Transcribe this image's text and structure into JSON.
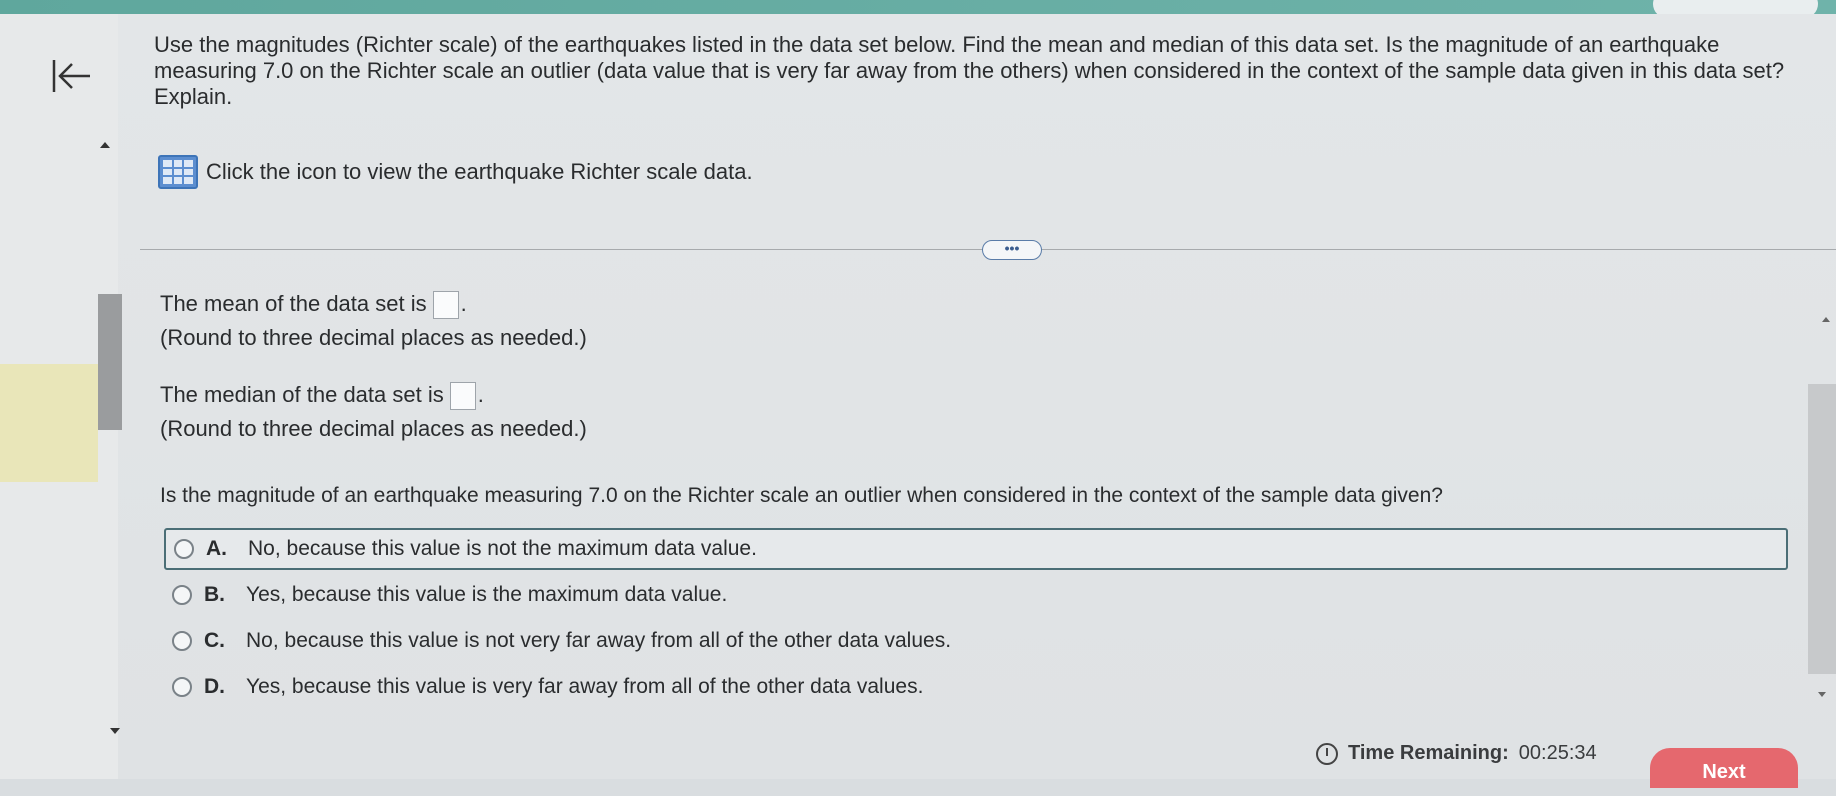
{
  "question": {
    "text": "Use the magnitudes (Richter scale) of the earthquakes listed in the data set below. Find the mean and median of this data set. Is the magnitude of an earthquake measuring 7.0 on the Richter scale an outlier (data value that is very far away from the others) when considered in the context of the sample data given in this data set? Explain."
  },
  "data_link": {
    "icon": "table-icon",
    "label": "Click the icon to view the earthquake Richter scale data."
  },
  "more_button": {
    "label": "•••"
  },
  "mean": {
    "prefix": "The mean of the data set is",
    "suffix": ".",
    "value": "",
    "hint": "(Round to three decimal places as needed.)"
  },
  "median": {
    "prefix": "The median of the data set is",
    "suffix": ".",
    "value": "",
    "hint": "(Round to three decimal places as needed.)"
  },
  "outlier_question": "Is the magnitude of an earthquake measuring 7.0 on the Richter scale an outlier when considered in the context of the sample data given?",
  "choices": [
    {
      "letter": "A.",
      "text": "No, because this value is not the maximum data value."
    },
    {
      "letter": "B.",
      "text": "Yes, because this value is the maximum data value."
    },
    {
      "letter": "C.",
      "text": "No, because this value is not very far away from all of the other data values."
    },
    {
      "letter": "D.",
      "text": "Yes, because this value is very far away from all of the other data values."
    }
  ],
  "footer": {
    "time_label": "Time Remaining:",
    "time_value": "00:25:34",
    "next_label": "Next"
  },
  "colors": {
    "header_band": "#5fa79d",
    "next_button": "#e5686e",
    "link_icon": "#5c8ed0"
  }
}
